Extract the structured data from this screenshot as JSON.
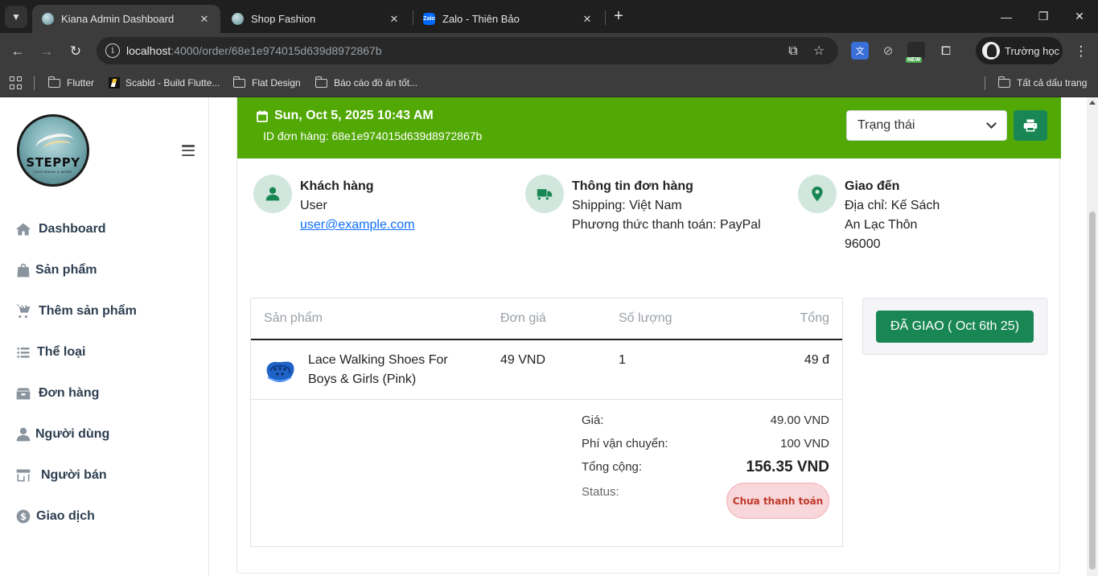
{
  "browser": {
    "tabs": [
      {
        "title": "Kiana Admin Dashboard",
        "active": true
      },
      {
        "title": "Shop Fashion",
        "active": false
      },
      {
        "title": "Zalo - Thiên Bảo",
        "active": false
      }
    ],
    "url_host": "localhost",
    "url_rest": ":4000/order/68e1e974015d639d8972867b",
    "extension_badge": "NEW",
    "profile_name": "Trường học",
    "bookmarks": [
      "Flutter",
      "Scabld - Build Flutte...",
      "Flat Design",
      "Báo cáo đồ án tốt..."
    ],
    "all_bookmarks": "Tất cả dấu trang"
  },
  "sidebar": {
    "logo_text": "STEPPY",
    "logo_tagline": "FOOTWEAR & MORE",
    "items": [
      {
        "label": "Dashboard",
        "icon": "home-icon"
      },
      {
        "label": "Sản phẩm",
        "icon": "shopping-bag-icon"
      },
      {
        "label": "Thêm sản phẩm",
        "icon": "cart-plus-icon"
      },
      {
        "label": "Thể loại",
        "icon": "list-icon"
      },
      {
        "label": "Đơn hàng",
        "icon": "box-icon"
      },
      {
        "label": "Người dùng",
        "icon": "user-icon"
      },
      {
        "label": "Người bán",
        "icon": "store-icon"
      },
      {
        "label": "Giao dịch",
        "icon": "dollar-icon"
      }
    ]
  },
  "order": {
    "date": "Sun, Oct 5, 2025 10:43 AM",
    "id_line": "ID đơn hàng: 68e1e974015d639d8972867b",
    "status_placeholder": "Trạng thái",
    "customer": {
      "heading": "Khách hàng",
      "name": "User",
      "email": "user@example.com"
    },
    "order_info": {
      "heading": "Thông tin đơn hàng",
      "shipping": "Shipping: Việt Nam",
      "payment": "Phương thức thanh toán: PayPal"
    },
    "delivery": {
      "heading": "Giao đến",
      "address": "Địa chỉ: Kế Sách",
      "line2": "An Lạc Thôn",
      "zip": "96000"
    },
    "table": {
      "headers": [
        "Sản phẩm",
        "Đơn giá",
        "Số lượng",
        "Tổng"
      ],
      "items": [
        {
          "name_line1": "Lace Walking Shoes For",
          "name_line2": "Boys & Girls (Pink)",
          "price": "49 VND",
          "qty": "1",
          "total": "49 đ"
        }
      ]
    },
    "summary": {
      "price_label": "Giá:",
      "price": "49.00 VND",
      "shipping_label": "Phí vận chuyển:",
      "shipping": "100 VND",
      "total_label": "Tổng cộng:",
      "total": "156.35 VND",
      "status_label": "Status:",
      "status": "Chưa thanh toán"
    },
    "delivered_button": "ĐÃ GIAO ( Oct 6th 25)"
  },
  "colors": {
    "header_green": "#52a906",
    "button_green": "#198754",
    "unpaid_red": "#c0392b"
  }
}
